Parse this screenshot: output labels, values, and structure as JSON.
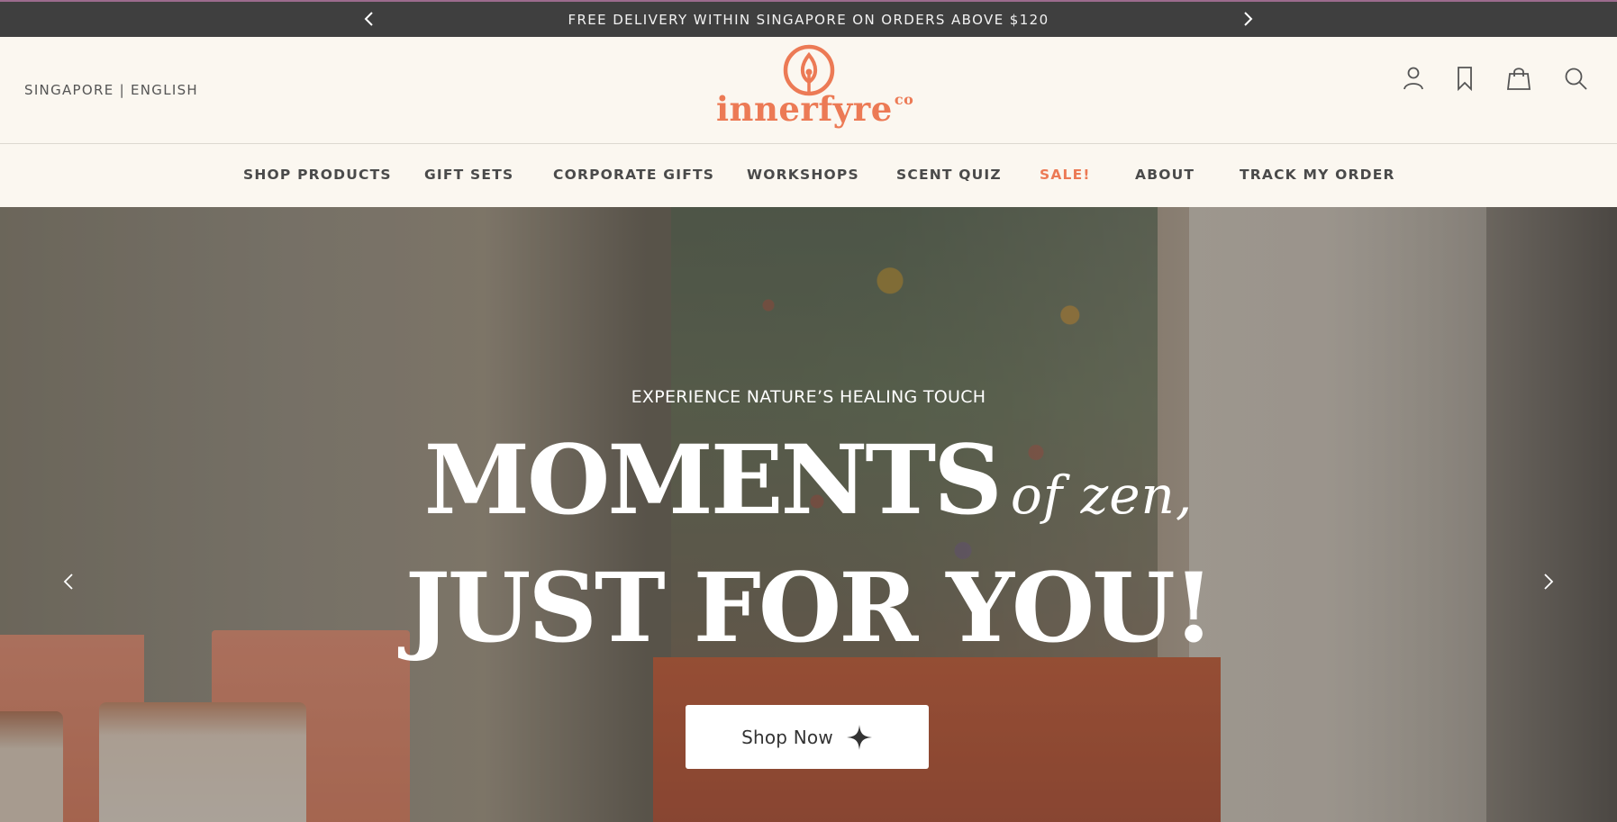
{
  "announcement": {
    "text": "FREE DELIVERY WITHIN SINGAPORE ON ORDERS ABOVE $120",
    "prev_icon": "chevron-left-icon",
    "next_icon": "chevron-right-icon"
  },
  "header": {
    "locale": "SINGAPORE | ENGLISH",
    "logo": {
      "word": "innerfyre",
      "suffix": "co"
    },
    "icons": [
      "account-icon",
      "bookmark-icon",
      "bag-icon",
      "search-icon"
    ]
  },
  "nav": {
    "items": [
      {
        "label": "SHOP PRODUCTS"
      },
      {
        "label": "GIFT SETS"
      },
      {
        "label": "CORPORATE GIFTS"
      },
      {
        "label": "WORKSHOPS"
      },
      {
        "label": "SCENT QUIZ"
      },
      {
        "label": "SALE!"
      },
      {
        "label": "ABOUT"
      },
      {
        "label": "TRACK MY ORDER"
      }
    ]
  },
  "hero": {
    "subtitle": "EXPERIENCE NATURE’S HEALING TOUCH",
    "title_line1": "MOMENTS",
    "title_script": "of zen,",
    "title_line2": "JUST FOR YOU!",
    "cta_label": "Shop Now",
    "cta_icon": "sparkle-icon"
  },
  "colors": {
    "accent": "#ec7a55",
    "announcement_bg": "#3f3f3f",
    "page_bg": "#fbf7f0"
  }
}
